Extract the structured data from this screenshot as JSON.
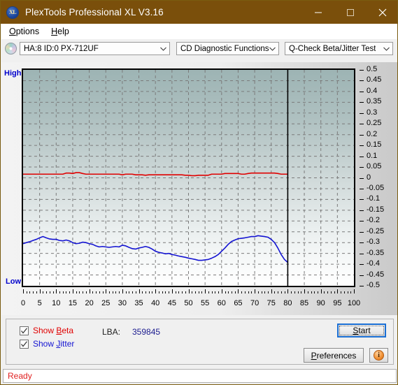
{
  "window": {
    "title": "PlexTools Professional XL V3.16",
    "icon": "xl-app-icon",
    "icon_text": "XL",
    "minimize": "minimize-icon",
    "maximize": "maximize-icon",
    "close": "close-icon",
    "titlebar_color": "#7a4f0b"
  },
  "menu": {
    "items": [
      {
        "label": "Options",
        "accel": "O"
      },
      {
        "label": "Help",
        "accel": "H"
      }
    ]
  },
  "toolbar": {
    "drive_icon": "disc-icon",
    "drive": {
      "value": "HA:8 ID:0  PX-712UF"
    },
    "function": {
      "value": "CD Diagnostic Functions"
    },
    "test": {
      "value": "Q-Check Beta/Jitter Test"
    }
  },
  "chart_data": {
    "type": "line",
    "title": "Q-Check Beta/Jitter Test",
    "xlabel": "",
    "ylabel": "",
    "xlim": [
      0,
      100
    ],
    "ylim": [
      -0.5,
      0.5
    ],
    "grid": true,
    "legend_position": "bottom-left",
    "y_axis_side": "right",
    "left_axis_labels": {
      "top": "High",
      "bottom": "Low"
    },
    "xticks": [
      0,
      5,
      10,
      15,
      20,
      25,
      30,
      35,
      40,
      45,
      50,
      55,
      60,
      65,
      70,
      75,
      80,
      85,
      90,
      95,
      100
    ],
    "yticks": [
      0.5,
      0.45,
      0.4,
      0.35,
      0.3,
      0.25,
      0.2,
      0.15,
      0.1,
      0.05,
      0,
      -0.05,
      -0.1,
      -0.15,
      -0.2,
      -0.25,
      -0.3,
      -0.35,
      -0.4,
      -0.45,
      -0.5
    ],
    "cursor_x": 80,
    "data_end_x": 80,
    "series": [
      {
        "name": "Jitter",
        "color": "#e00000",
        "x": [
          0,
          1,
          2,
          3,
          4,
          5,
          6,
          7,
          8,
          9,
          10,
          11,
          12,
          13,
          14,
          15,
          16,
          17,
          18,
          19,
          20,
          21,
          22,
          23,
          24,
          25,
          26,
          27,
          28,
          29,
          30,
          31,
          32,
          33,
          34,
          35,
          36,
          37,
          38,
          39,
          40,
          41,
          42,
          43,
          44,
          45,
          46,
          47,
          48,
          49,
          50,
          51,
          52,
          53,
          54,
          55,
          56,
          57,
          58,
          59,
          60,
          61,
          62,
          63,
          64,
          65,
          66,
          67,
          68,
          69,
          70,
          71,
          72,
          73,
          74,
          75,
          76,
          77,
          78,
          79,
          80
        ],
        "values": [
          0.017,
          0.017,
          0.017,
          0.017,
          0.017,
          0.017,
          0.017,
          0.017,
          0.017,
          0.017,
          0.017,
          0.017,
          0.017,
          0.022,
          0.022,
          0.02,
          0.024,
          0.024,
          0.02,
          0.017,
          0.017,
          0.017,
          0.017,
          0.017,
          0.017,
          0.017,
          0.017,
          0.017,
          0.017,
          0.017,
          0.014,
          0.017,
          0.017,
          0.017,
          0.014,
          0.014,
          0.014,
          0.012,
          0.014,
          0.014,
          0.014,
          0.014,
          0.014,
          0.014,
          0.014,
          0.014,
          0.014,
          0.014,
          0.014,
          0.012,
          0.012,
          0.01,
          0.01,
          0.012,
          0.012,
          0.012,
          0.012,
          0.017,
          0.017,
          0.017,
          0.017,
          0.02,
          0.02,
          0.02,
          0.02,
          0.02,
          0.017,
          0.017,
          0.02,
          0.022,
          0.022,
          0.022,
          0.022,
          0.022,
          0.022,
          0.022,
          0.022,
          0.02,
          0.017,
          0.017,
          0.017
        ]
      },
      {
        "name": "Beta",
        "color": "#1414d2",
        "x": [
          0,
          1,
          2,
          3,
          4,
          5,
          6,
          7,
          8,
          9,
          10,
          11,
          12,
          13,
          14,
          15,
          16,
          17,
          18,
          19,
          20,
          21,
          22,
          23,
          24,
          25,
          26,
          27,
          28,
          29,
          30,
          31,
          32,
          33,
          34,
          35,
          36,
          37,
          38,
          39,
          40,
          41,
          42,
          43,
          44,
          45,
          46,
          47,
          48,
          49,
          50,
          51,
          52,
          53,
          54,
          55,
          56,
          57,
          58,
          59,
          60,
          61,
          62,
          63,
          64,
          65,
          66,
          67,
          68,
          69,
          70,
          71,
          72,
          73,
          74,
          75,
          76,
          77,
          78,
          79,
          80
        ],
        "values": [
          -0.305,
          -0.3,
          -0.296,
          -0.29,
          -0.285,
          -0.278,
          -0.272,
          -0.278,
          -0.283,
          -0.285,
          -0.285,
          -0.29,
          -0.292,
          -0.288,
          -0.292,
          -0.3,
          -0.305,
          -0.303,
          -0.298,
          -0.3,
          -0.305,
          -0.308,
          -0.315,
          -0.32,
          -0.318,
          -0.32,
          -0.322,
          -0.32,
          -0.318,
          -0.32,
          -0.312,
          -0.315,
          -0.322,
          -0.328,
          -0.33,
          -0.325,
          -0.322,
          -0.318,
          -0.322,
          -0.33,
          -0.34,
          -0.345,
          -0.348,
          -0.352,
          -0.35,
          -0.355,
          -0.358,
          -0.362,
          -0.365,
          -0.368,
          -0.372,
          -0.375,
          -0.378,
          -0.382,
          -0.382,
          -0.38,
          -0.378,
          -0.372,
          -0.365,
          -0.355,
          -0.34,
          -0.325,
          -0.308,
          -0.295,
          -0.288,
          -0.282,
          -0.28,
          -0.278,
          -0.275,
          -0.272,
          -0.272,
          -0.268,
          -0.27,
          -0.272,
          -0.275,
          -0.285,
          -0.3,
          -0.325,
          -0.355,
          -0.378,
          -0.392
        ]
      }
    ]
  },
  "controls": {
    "show_beta": {
      "label": "Show Beta",
      "accel": "B",
      "checked": true,
      "color": "#e00000"
    },
    "show_jitter": {
      "label": "Show Jitter",
      "accel": "J",
      "checked": true,
      "color": "#1414d2"
    },
    "lba": {
      "label": "LBA:",
      "value": "359845"
    },
    "start_button": {
      "label": "Start",
      "accel": "S"
    },
    "preferences_button": {
      "label": "Preferences",
      "accel": "P"
    },
    "info_button": {
      "icon": "info-icon",
      "glyph": "i"
    }
  },
  "statusbar": {
    "text": "Ready",
    "color": "#e02020"
  }
}
